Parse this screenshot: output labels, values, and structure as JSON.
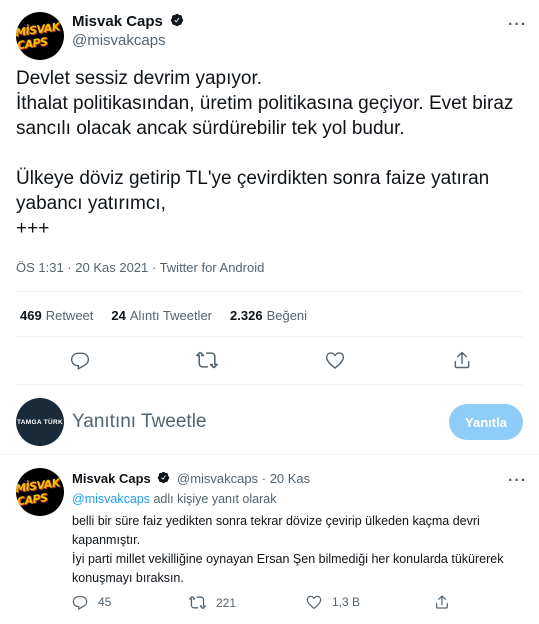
{
  "tweet": {
    "author_name": "Misvak Caps",
    "author_handle": "@misvakcaps",
    "avatar_text": "MİSVAK CAPS",
    "more_label": "···",
    "text": "Devlet sessiz devrim yapıyor.\n İthalat politikasından, üretim politikasına geçiyor. Evet biraz sancılı olacak ancak sürdürebilir tek yol budur.\n\nÜlkeye döviz getirip TL'ye çevirdikten sonra faize yatıran yabancı yatırımcı,\n+++",
    "meta": "ÖS 1:31 · 20 Kas 2021 · Twitter for Android",
    "stats": {
      "retweets": "469",
      "retweets_label": "Retweet",
      "quotes": "24",
      "quotes_label": "Alıntı Tweetler",
      "likes": "2.326",
      "likes_label": "Beğeni"
    },
    "actions": [
      "reply-icon",
      "retweet-icon",
      "like-icon",
      "share-icon"
    ]
  },
  "compose": {
    "avatar_text": "TAMGA TÜRK",
    "placeholder": "Yanıtını Tweetle",
    "button_label": "Yanıtla",
    "button_color": "#8ecdf8"
  },
  "reply": {
    "author_name": "Misvak Caps",
    "author_handle": "@misvakcaps",
    "time": "· 20 Kas",
    "more_label": "···",
    "replying_to_handle": "@misvakcaps",
    "replying_to_suffix": " adlı kişiye yanıt olarak",
    "text": "belli bir süre  faiz yedikten sonra tekrar dövize çevirip ülkeden kaçma devri kapanmıştır.\nİyi parti millet vekilliğine oynayan Ersan Şen bilmediği her konularda tükürerek konuşmayı bıraksın.",
    "counts": {
      "replies": "45",
      "retweets": "221",
      "likes": "",
      "views": "1,3 B"
    }
  },
  "colors": {
    "accent": "#1d9bf0",
    "text": "#0f1419",
    "muted": "#536471",
    "divider": "#eff3f4"
  }
}
